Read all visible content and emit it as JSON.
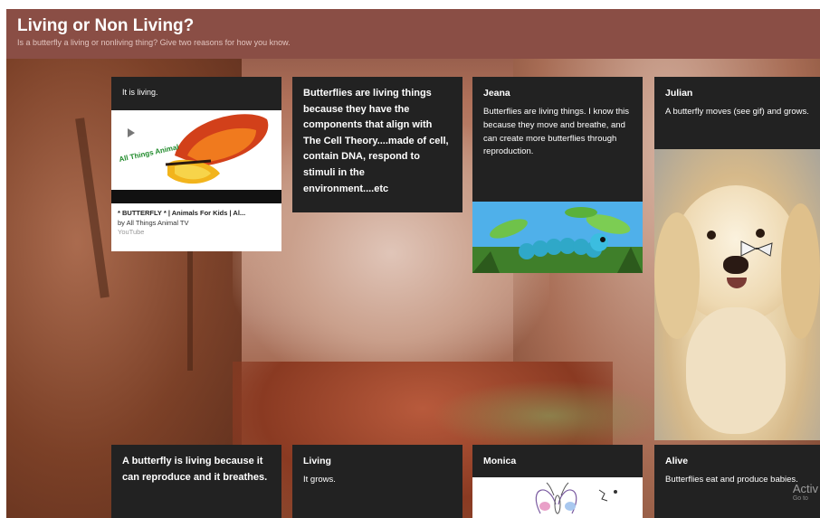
{
  "header": {
    "title": "Living or Non Living?",
    "subtitle": "Is a butterfly a living or nonliving thing? Give two reasons for how you know."
  },
  "posts": [
    {
      "id": "post-1",
      "text": "It is living.",
      "attachment": {
        "title": "* BUTTERFLY * | Animals For Kids | Al...",
        "channel": "by All Things Animal TV",
        "source": "YouTube",
        "thumbnail_text": "All Things Animal"
      }
    },
    {
      "id": "post-2",
      "text": "Butterflies are living things because they have the components that align with The Cell Theory....made of cell, contain DNA, respond to stimuli in the environment....etc"
    },
    {
      "id": "post-3",
      "author": "Jeana",
      "text": "Butterflies are living things. I know this because they move and breathe, and can create more butterflies through reproduction."
    },
    {
      "id": "post-4",
      "author": "Julian",
      "text": "A butterfly moves (see gif) and grows."
    },
    {
      "id": "post-5",
      "text": "A butterfly is living because it can reproduce and it breathes."
    },
    {
      "id": "post-6",
      "author": "Living",
      "text": "It grows."
    },
    {
      "id": "post-7",
      "author": "Monica"
    },
    {
      "id": "post-8",
      "author": "Alive",
      "text": "Butterflies eat and produce babies."
    }
  ],
  "watermark": {
    "line1": "Activ",
    "line2": "Go to"
  },
  "colors": {
    "header_bg": "#8a4e45",
    "card_bg": "#222222",
    "card_text": "#ffffff"
  }
}
